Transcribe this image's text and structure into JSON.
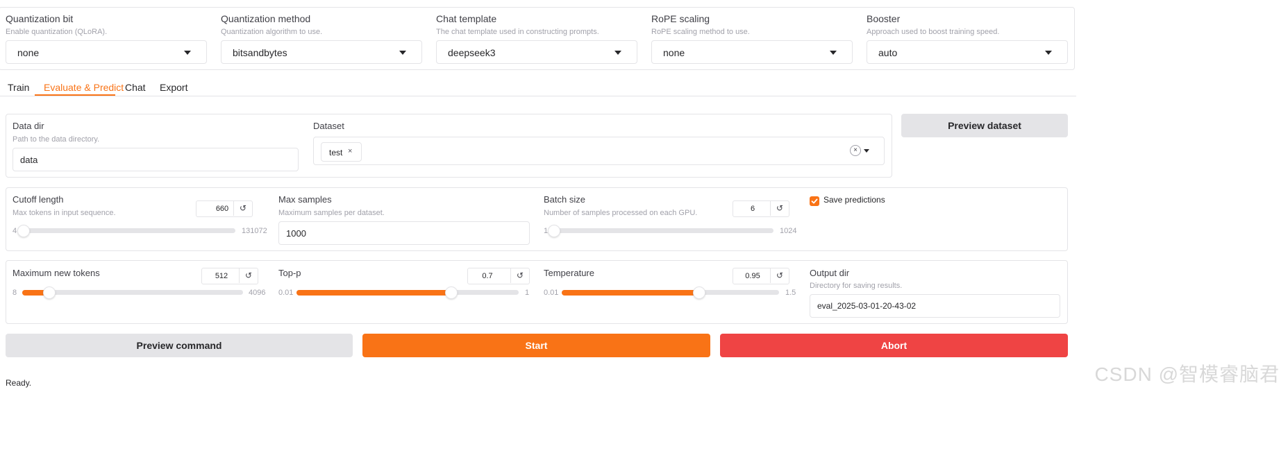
{
  "top_settings": {
    "quantization_bit": {
      "label": "Quantization bit",
      "info": "Enable quantization (QLoRA).",
      "value": "none"
    },
    "quantization_method": {
      "label": "Quantization method",
      "info": "Quantization algorithm to use.",
      "value": "bitsandbytes"
    },
    "chat_template": {
      "label": "Chat template",
      "info": "The chat template used in constructing prompts.",
      "value": "deepseek3"
    },
    "rope_scaling": {
      "label": "RoPE scaling",
      "info": "RoPE scaling method to use.",
      "value": "none"
    },
    "booster": {
      "label": "Booster",
      "info": "Approach used to boost training speed.",
      "value": "auto"
    }
  },
  "tabs": [
    {
      "label": "Train",
      "active": false
    },
    {
      "label": "Evaluate & Predict",
      "active": true
    },
    {
      "label": "Chat",
      "active": false
    },
    {
      "label": "Export",
      "active": false
    }
  ],
  "data_section": {
    "data_dir": {
      "label": "Data dir",
      "info": "Path to the data directory.",
      "value": "data"
    },
    "dataset": {
      "label": "Dataset",
      "selected": [
        "test"
      ],
      "clear_glyph": "×"
    },
    "preview_dataset_label": "Preview dataset"
  },
  "params_row1": {
    "cutoff_length": {
      "label": "Cutoff length",
      "info": "Max tokens in input sequence.",
      "value": "660",
      "min": "4",
      "max": "131072",
      "fraction": 0.0049
    },
    "max_samples": {
      "label": "Max samples",
      "info": "Maximum samples per dataset.",
      "value": "1000"
    },
    "batch_size": {
      "label": "Batch size",
      "info": "Number of samples processed on each GPU.",
      "value": "6",
      "min": "1",
      "max": "1024",
      "fraction": 0.0049
    },
    "save_predictions": {
      "label": "Save predictions",
      "checked": true
    }
  },
  "params_row2": {
    "max_new_tokens": {
      "label": "Maximum new tokens",
      "value": "512",
      "min": "8",
      "max": "4096",
      "fraction": 0.1233
    },
    "top_p": {
      "label": "Top-p",
      "value": "0.7",
      "min": "0.01",
      "max": "1",
      "fraction": 0.697
    },
    "temperature": {
      "label": "Temperature",
      "value": "0.95",
      "min": "0.01",
      "max": "1.5",
      "fraction": 0.631
    },
    "output_dir": {
      "label": "Output dir",
      "info": "Directory for saving results.",
      "value": "eval_2025-03-01-20-43-02"
    }
  },
  "actions": {
    "preview_command": "Preview command",
    "start": "Start",
    "abort": "Abort"
  },
  "reset_glyph": "↺",
  "status_text": "Ready.",
  "watermark": "CSDN @智模睿脑君",
  "colors": {
    "accent": "#f97316",
    "stop": "#ef4444",
    "secondary": "#e4e4e7"
  }
}
